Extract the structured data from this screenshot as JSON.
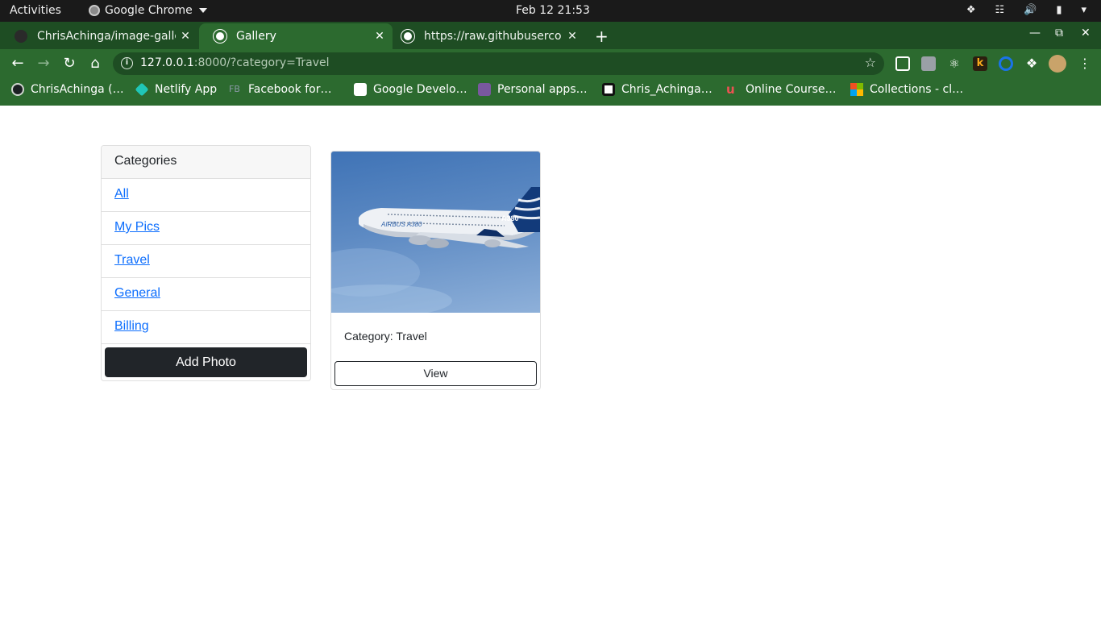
{
  "system_bar": {
    "activities": "Activities",
    "app_name": "Google Chrome",
    "datetime": "Feb 12  21:53"
  },
  "tabs": [
    {
      "title": "ChrisAchinga/image-galle",
      "icon": "github-icon"
    },
    {
      "title": "Gallery",
      "icon": "globe-icon"
    },
    {
      "title": "https://raw.githubuserco",
      "icon": "globe-icon"
    }
  ],
  "address_bar": {
    "host": "127.0.0.1",
    "rest": ":8000/?category=Travel"
  },
  "bookmarks": [
    {
      "label": "ChrisAchinga (…",
      "icon": "github-icon",
      "color": "#1b1f23"
    },
    {
      "label": "Netlify App",
      "icon": "netlify-icon",
      "color": "#20c6b7"
    },
    {
      "label": "Facebook for…",
      "icon": "facebook-for-developers-icon",
      "color": "#6b7c8c",
      "abbr": "FB"
    },
    {
      "label": "Google Develo…",
      "icon": "google-developers-icon",
      "color": "#ffffff"
    },
    {
      "label": "Personal apps…",
      "icon": "heroku-icon",
      "color": "#79589f"
    },
    {
      "label": "Chris_Achinga…",
      "icon": "codepen-icon",
      "color": "#ffffff"
    },
    {
      "label": "Online Course…",
      "icon": "udemy-icon",
      "color": "#ec5252"
    },
    {
      "label": "Collections - cl…",
      "icon": "microsoft-icon",
      "color": "#f25022"
    }
  ],
  "sidebar": {
    "header": "Categories",
    "items": [
      {
        "label": "All"
      },
      {
        "label": "My Pics"
      },
      {
        "label": "Travel"
      },
      {
        "label": "General"
      },
      {
        "label": "Billing"
      }
    ],
    "add_button": "Add Photo"
  },
  "gallery": {
    "cards": [
      {
        "image_alt": "airplane-photo",
        "category_text": "Category: Travel",
        "button": "View"
      }
    ]
  },
  "colors": {
    "chrome_dark": "#1e4d23",
    "chrome_light": "#2c6a2f",
    "link": "#0d6efd",
    "dark_button": "#212529"
  }
}
